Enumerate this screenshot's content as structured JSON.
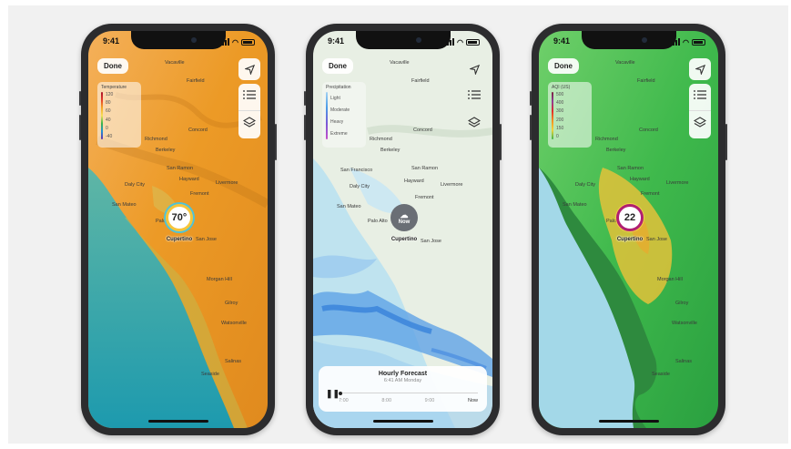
{
  "phones": [
    {
      "status_time": "9:41",
      "done_label": "Done",
      "legend": {
        "title": "Temperature",
        "stops": [
          "120",
          "80",
          "60",
          "40",
          "0",
          "-40"
        ]
      },
      "pin": {
        "value": "70°",
        "label": "Cupertino"
      },
      "cities": [
        "Vacaville",
        "Fairfield",
        "Concord",
        "Richmond",
        "Berkeley",
        "San Ramon",
        "Daly City",
        "Fremont",
        "Livermore",
        "Hayward",
        "San Mateo",
        "Palo Alto",
        "San Jose",
        "Morgan Hill",
        "Gilroy",
        "Watsonville",
        "Salinas",
        "Seaside"
      ]
    },
    {
      "status_time": "9:41",
      "done_label": "Done",
      "legend": {
        "title": "Precipitation",
        "stops": [
          "Light",
          "Moderate",
          "Heavy",
          "Extreme"
        ]
      },
      "pin": {
        "value": "Now",
        "label": "Cupertino"
      },
      "cities": [
        "Vacaville",
        "Fairfield",
        "Concord",
        "Richmond",
        "Berkeley",
        "San Ramon",
        "San Francisco",
        "Daly City",
        "Hayward",
        "Livermore",
        "Fremont",
        "San Mateo",
        "Palo Alto",
        "San Jose"
      ],
      "forecast": {
        "title": "Hourly Forecast",
        "subtitle": "6:41 AM Monday",
        "ticks": [
          "7:00",
          "8:00",
          "9:00",
          "Now"
        ],
        "progress": 0.0
      }
    },
    {
      "status_time": "9:41",
      "done_label": "Done",
      "legend": {
        "title": "AQI (US)",
        "stops": [
          "500",
          "400",
          "300",
          "200",
          "150",
          "0"
        ]
      },
      "pin": {
        "value": "22",
        "label": "Cupertino"
      },
      "cities": [
        "Vacaville",
        "Fairfield",
        "Concord",
        "Richmond",
        "Berkeley",
        "San Ramon",
        "Daly City",
        "Fremont",
        "Livermore",
        "Hayward",
        "San Mateo",
        "Palo Alto",
        "San Jose",
        "Morgan Hill",
        "Gilroy",
        "Watsonville",
        "Salinas",
        "Seaside"
      ]
    }
  ],
  "icons": {
    "location": "location-arrow-icon",
    "list": "list-icon",
    "layers": "layers-icon",
    "play_pause": "pause-icon"
  },
  "colors": {
    "temp_ocean": "#2aa6a8",
    "temp_land": "#e89a24",
    "precip_ocean": "#bfe4f0",
    "precip_land": "#e6efe1",
    "aqi_ocean": "#9fd6e8",
    "aqi_land": "#35b24a"
  }
}
